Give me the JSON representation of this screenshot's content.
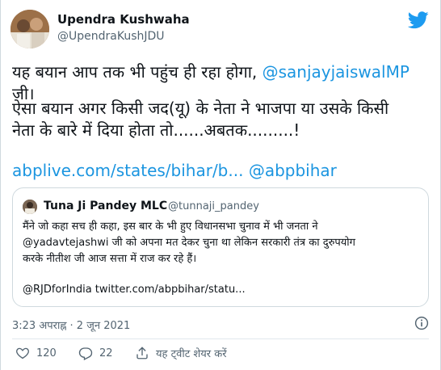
{
  "tweet": {
    "author": {
      "name": "Upendra Kushwaha",
      "handle": "@UpendraKushJDU"
    },
    "text": {
      "line1_pre": "यह बयान आप तक भी पहुंच ही रहा होगा, ",
      "line1_mention": "@sanjayjaiswalMP",
      "line1_post": " जी।",
      "line2": "ऐसा बयान अगर किसी जद(यू) के नेता ने भाजपा या उसके किसी",
      "line3": "नेता के बारे में दिया होता तो......अबतक.........!",
      "link": "abplive.com/states/bihar/b...",
      "mention2": "@abpbihar"
    },
    "quoted": {
      "name": "Tuna Ji Pandey MLC",
      "handle": "@tunnaji_pandey",
      "line1": "मैंने जो कहा सच ही कहा, इस बार के भी हुए विधानसभा चुनाव में भी जनता ने",
      "line2": "@yadavtejashwi जी को अपना मत देकर चुना था लेकिन सरकारी तंत्र का दुरुपयोग",
      "line3": "करके नीतीश जी आज सत्ता में राज कर रहे हैं।",
      "links": "@RJDforIndia twitter.com/abpbihar/statu..."
    },
    "timestamp": "3:23 अपराह्न · 2 जून 2021",
    "actions": {
      "likes": "120",
      "replies": "22",
      "share_label": "यह ट्वीट शेयर करें"
    }
  },
  "colors": {
    "link": "#1b95e0",
    "brand": "#1d9bf0",
    "secondary_text": "#536471"
  },
  "icons": [
    "twitter-bird-icon",
    "info-icon",
    "heart-icon",
    "reply-icon",
    "share-icon"
  ]
}
